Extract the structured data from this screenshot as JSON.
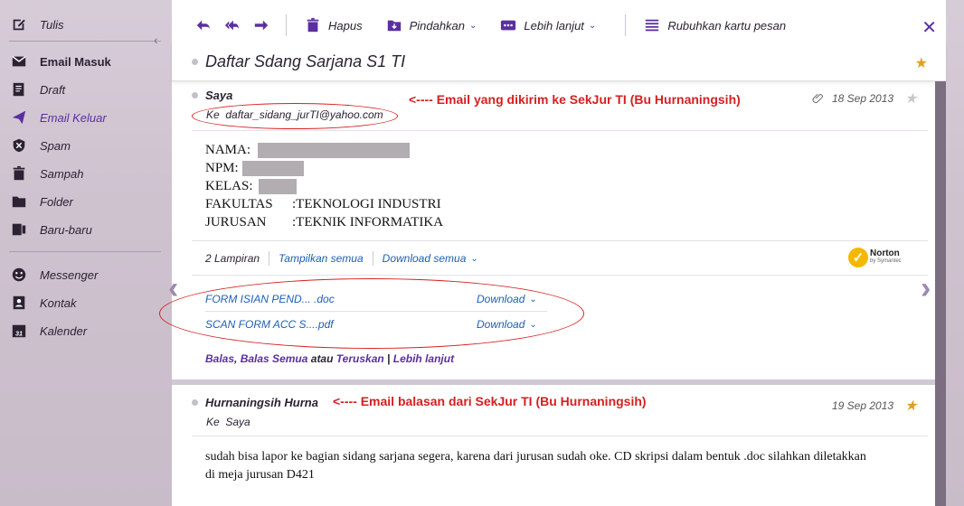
{
  "sidebar": {
    "items": [
      {
        "label": "Tulis",
        "icon": "compose-icon"
      },
      {
        "label": "Email Masuk",
        "icon": "inbox-icon"
      },
      {
        "label": "Draft",
        "icon": "draft-icon"
      },
      {
        "label": "Email Keluar",
        "icon": "sent-icon"
      },
      {
        "label": "Spam",
        "icon": "spam-icon"
      },
      {
        "label": "Sampah",
        "icon": "trash-icon"
      },
      {
        "label": "Folder",
        "icon": "folder-icon"
      },
      {
        "label": "Baru-baru",
        "icon": "recent-icon"
      },
      {
        "label": "Messenger",
        "icon": "messenger-icon"
      },
      {
        "label": "Kontak",
        "icon": "contacts-icon"
      },
      {
        "label": "Kalender",
        "icon": "calendar-icon"
      }
    ],
    "calendar_day": "31"
  },
  "toolbar": {
    "delete_label": "Hapus",
    "move_label": "Pindahkan",
    "more_label": "Lebih lanjut",
    "summary_label": "Rubuhkan kartu pesan"
  },
  "conversation": {
    "subject": "Daftar Sdang Sarjana S1 TI"
  },
  "message1": {
    "sender": "Saya",
    "annotation": "<---- Email yang dikirim ke SekJur TI (Bu Hurnaningsih)",
    "date": "18 Sep 2013",
    "to_prefix": "Ke",
    "to_address": "daftar_sidang_jurTI@yahoo.com",
    "fields": [
      {
        "key": "NAMA",
        "sep": " :",
        "value": ""
      },
      {
        "key": "NPM",
        "sep": " :",
        "value": ""
      },
      {
        "key": "KELAS",
        "sep": " :",
        "value": ""
      },
      {
        "key": "FAKULTAS",
        "sep": ": ",
        "value": "TEKNOLOGI INDUSTRI"
      },
      {
        "key": "JURUSAN",
        "sep": ": ",
        "value": "TEKNIK INFORMATIKA"
      }
    ],
    "attachment_count": "2 Lampiran",
    "show_all": "Tampilkan semua",
    "download_all": "Download semua",
    "norton_brand": "Norton",
    "norton_sub": "by Symantec",
    "attachments": [
      {
        "name": "FORM ISIAN PEND... .doc",
        "download": "Download"
      },
      {
        "name": "SCAN FORM ACC S....pdf",
        "download": "Download"
      }
    ],
    "actions": {
      "reply": "Balas",
      "reply_all": "Balas Semua",
      "or": "atau",
      "forward": "Teruskan",
      "more": "Lebih lanjut"
    }
  },
  "message2": {
    "sender": "Hurnaningsih Hurna",
    "annotation": "<---- Email balasan dari SekJur TI (Bu Hurnaningsih)",
    "date": "19 Sep 2013",
    "to_prefix": "Ke",
    "to_name": "Saya",
    "body": "sudah bisa lapor ke bagian sidang sarjana segera, karena dari jurusan sudah oke. CD skripsi dalam bentuk .doc silahkan diletakkan di meja jurusan D421"
  },
  "colors": {
    "accent": "#5b2fa0",
    "annotation": "#d52020",
    "link": "#1f5fb3",
    "star": "#e0a020"
  }
}
